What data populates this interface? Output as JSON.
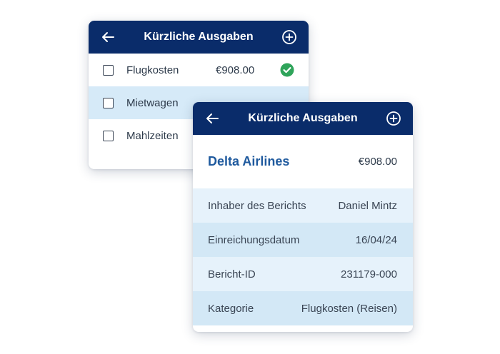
{
  "back_card": {
    "title": "Kürzliche Ausgaben",
    "back_icon": "arrow-left-icon",
    "add_icon": "plus-circle-icon",
    "items": [
      {
        "label": "Flugkosten",
        "amount": "€908.00",
        "checked_status": "check-circle-icon"
      },
      {
        "label": "Mietwagen",
        "amount": ""
      },
      {
        "label": "Mahlzeiten",
        "amount": ""
      }
    ]
  },
  "front_card": {
    "title": "Kürzliche Ausgaben",
    "back_icon": "arrow-left-icon",
    "add_icon": "plus-circle-icon",
    "airline": "Delta Airlines",
    "amount": "€908.00",
    "details": [
      {
        "label": "Inhaber des Berichts",
        "value": "Daniel Mintz"
      },
      {
        "label": "Einreichungsdatum",
        "value": "16/04/24"
      },
      {
        "label": "Bericht-ID",
        "value": "231179-000"
      },
      {
        "label": "Kategorie",
        "value": "Flugkosten (Reisen)"
      }
    ]
  },
  "colors": {
    "header": "#0a2c6a",
    "accent_blue": "#1f5a9e",
    "row_highlight": "#d6eaf8",
    "success_green": "#2fa45a"
  }
}
